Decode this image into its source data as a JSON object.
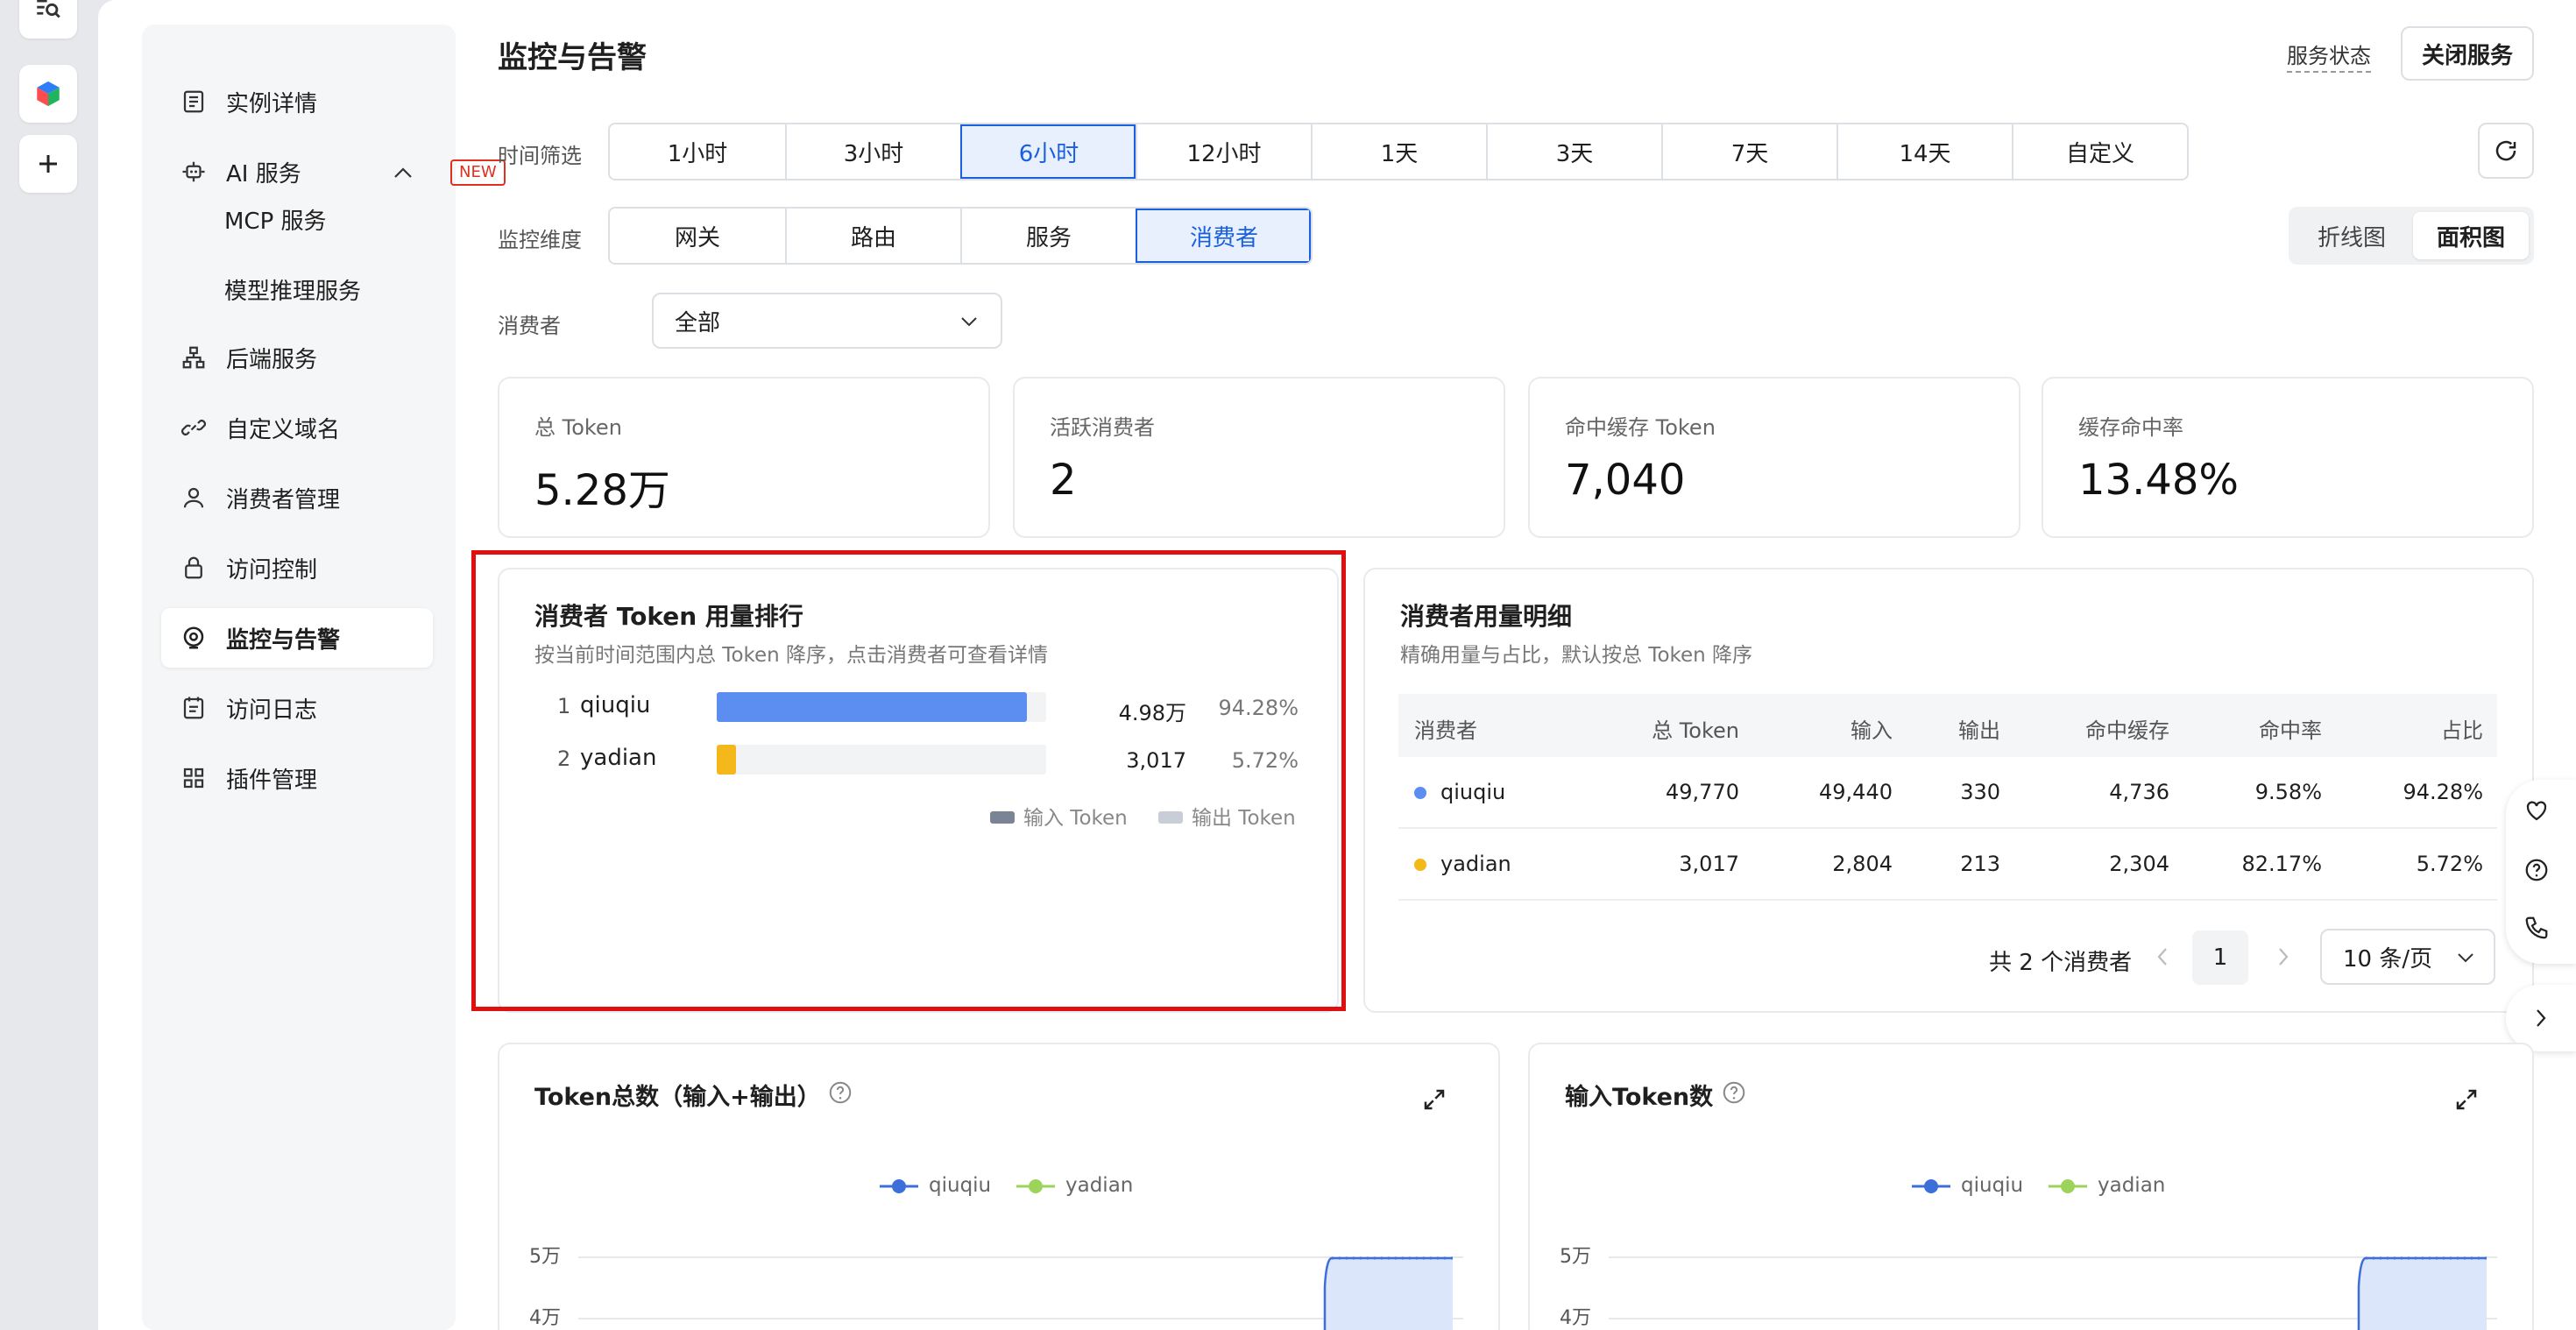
{
  "colors": {
    "accent": "#1a5fdd",
    "series_qiuqiu": "#5b8ef0",
    "series_yadian": "#f5b81a",
    "highlight_border": "#e01010",
    "chart_fill": "#dbe6fb",
    "chart_line": "#3d6fd9",
    "yadian_line": "#9cd35a"
  },
  "sidebar": {
    "items": [
      {
        "label": "实例详情",
        "icon": "document-icon"
      },
      {
        "label": "AI 服务",
        "icon": "ai-robot-icon",
        "badge": "NEW"
      },
      {
        "label": "后端服务",
        "icon": "sitemap-icon"
      },
      {
        "label": "自定义域名",
        "icon": "link-icon"
      },
      {
        "label": "消费者管理",
        "icon": "user-icon"
      },
      {
        "label": "访问控制",
        "icon": "lock-icon"
      },
      {
        "label": "监控与告警",
        "icon": "monitor-icon"
      },
      {
        "label": "访问日志",
        "icon": "log-icon"
      },
      {
        "label": "插件管理",
        "icon": "grid-icon"
      }
    ],
    "subitems": [
      "MCP 服务",
      "模型推理服务"
    ]
  },
  "header": {
    "title": "监控与告警",
    "status_link": "服务状态",
    "close_button": "关闭服务"
  },
  "filters": {
    "time_label": "时间筛选",
    "time_options": [
      "1小时",
      "3小时",
      "6小时",
      "12小时",
      "1天",
      "3天",
      "7天",
      "14天",
      "自定义"
    ],
    "time_selected": "6小时",
    "dim_label": "监控维度",
    "dim_options": [
      "网关",
      "路由",
      "服务",
      "消费者"
    ],
    "dim_selected": "消费者",
    "consumer_label": "消费者",
    "consumer_value": "全部",
    "chart_types": [
      "折线图",
      "面积图"
    ],
    "chart_type_selected": "面积图"
  },
  "stats": [
    {
      "label": "总 Token",
      "value": "5.28万"
    },
    {
      "label": "活跃消费者",
      "value": "2"
    },
    {
      "label": "命中缓存 Token",
      "value": "7,040"
    },
    {
      "label": "缓存命中率",
      "value": "13.48%"
    }
  ],
  "ranking": {
    "title": "消费者 Token 用量排行",
    "subtitle": "按当前时间范围内总 Token 降序，点击消费者可查看详情",
    "rows": [
      {
        "rank": "1",
        "name": "qiuqiu",
        "value": "4.98万",
        "pct": "94.28%",
        "fraction": 0.9428
      },
      {
        "rank": "2",
        "name": "yadian",
        "value": "3,017",
        "pct": "5.72%",
        "fraction": 0.0572
      }
    ],
    "legend": [
      "输入 Token",
      "输出 Token"
    ]
  },
  "detail": {
    "title": "消费者用量明细",
    "subtitle": "精确用量与占比，默认按总 Token 降序",
    "columns": [
      "消费者",
      "总 Token",
      "输入",
      "输出",
      "命中缓存",
      "命中率",
      "占比"
    ],
    "rows": [
      [
        "qiuqiu",
        "49,770",
        "49,440",
        "330",
        "4,736",
        "9.58%",
        "94.28%"
      ],
      [
        "yadian",
        "3,017",
        "2,804",
        "213",
        "2,304",
        "82.17%",
        "5.72%"
      ]
    ],
    "total_text": "共 2 个消费者",
    "page": "1",
    "page_size": "10 条/页"
  },
  "charts": [
    {
      "title": "Token总数（输入+输出）",
      "legend": [
        "qiuqiu",
        "yadian"
      ],
      "yticks": [
        "5万",
        "4万"
      ]
    },
    {
      "title": "输入Token数",
      "legend": [
        "qiuqiu",
        "yadian"
      ],
      "yticks": [
        "5万",
        "4万"
      ]
    }
  ],
  "chart_data": [
    {
      "type": "area",
      "title": "Token总数（输入+输出）",
      "series": [
        {
          "name": "qiuqiu"
        },
        {
          "name": "yadian"
        }
      ],
      "ylim_visible_ticks": [
        "5万",
        "4万"
      ]
    },
    {
      "type": "area",
      "title": "输入Token数",
      "series": [
        {
          "name": "qiuqiu"
        },
        {
          "name": "yadian"
        }
      ],
      "ylim_visible_ticks": [
        "5万",
        "4万"
      ]
    }
  ]
}
